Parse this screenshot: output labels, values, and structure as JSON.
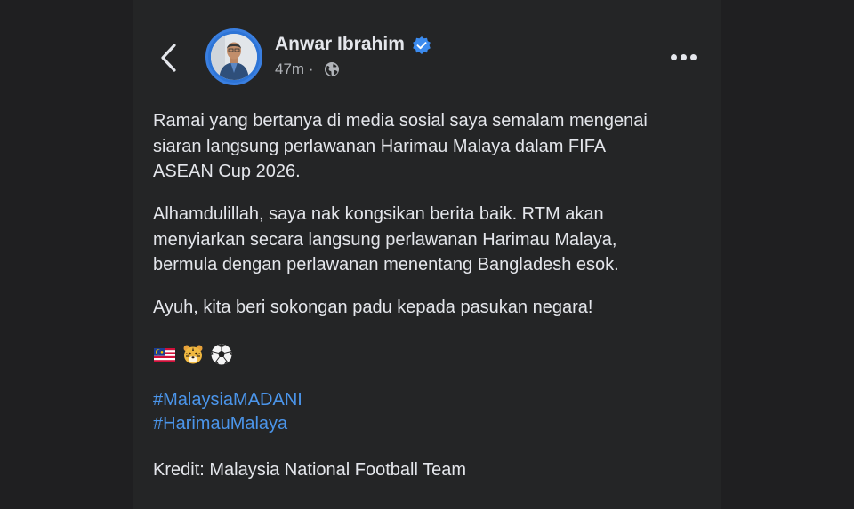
{
  "post": {
    "author": "Anwar Ibrahim",
    "time": "47m",
    "separator": "·",
    "paragraph1": {
      "line1": "Ramai yang bertanya di media sosial saya semalam mengenai",
      "line2": "siaran langsung perlawanan Harimau Malaya dalam FIFA",
      "line3": "ASEAN Cup 2026."
    },
    "paragraph2": {
      "line1": "Alhamdulillah, saya nak kongsikan berita baik. RTM akan",
      "line2": "menyiarkan secara langsung perlawanan Harimau Malaya,",
      "line3": "bermula dengan perlawanan menentang Bangladesh esok."
    },
    "paragraph3": "Ayuh, kita beri sokongan padu kepada pasukan negara!",
    "emojis": [
      "malaysia-flag-icon",
      "tiger-icon",
      "soccer-ball-icon"
    ],
    "hashtags": [
      "#MalaysiaMADANI",
      "#HarimauMalaya"
    ],
    "credit": "Kredit: Malaysia National Football Team"
  },
  "colors": {
    "background": "#242526",
    "text": "#e4e6eb",
    "secondary_text": "#b0b3b8",
    "link": "#4b95ea",
    "verified": "#3b8bef",
    "avatar_ring": "#3a7fe0"
  }
}
